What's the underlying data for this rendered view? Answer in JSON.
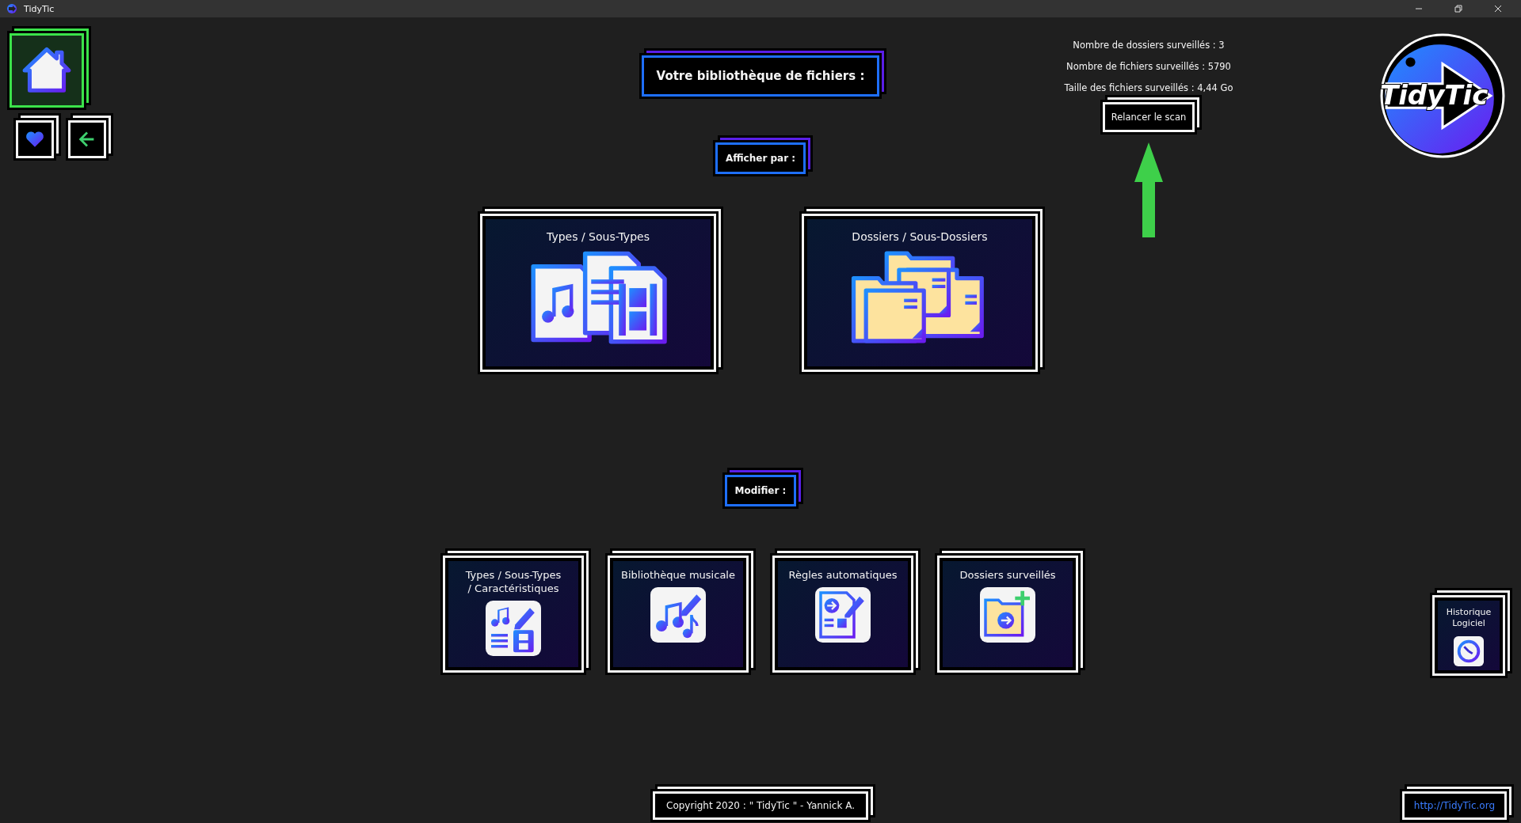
{
  "window": {
    "title": "TidyTic"
  },
  "nav_buttons": [
    {
      "kind": "home",
      "selected": true
    },
    {
      "kind": "favorites",
      "selected": false
    },
    {
      "kind": "back",
      "selected": false
    }
  ],
  "header": "Votre bibliothèque de fichiers :",
  "stats": [
    "Nombre de dossiers surveillés : 3",
    "Nombre de fichiers surveillés : 5790",
    "Taille des fichiers surveillés : 4,44 Go"
  ],
  "rescan_button": "Relancer le scan",
  "logo": {
    "text": "TidyTic"
  },
  "display_label": "Afficher par :",
  "display_options": [
    {
      "kind": "types",
      "label": "Types / Sous-Types"
    },
    {
      "kind": "folders",
      "label": "Dossiers / Sous-Dossiers"
    }
  ],
  "modify_label": "Modifier :",
  "modify_options": [
    {
      "kind": "types",
      "label": "Types / Sous-Types\n/ Caractéristiques"
    },
    {
      "kind": "music",
      "label": "Bibliothèque musicale"
    },
    {
      "kind": "rules",
      "label": "Règles automatiques"
    },
    {
      "kind": "folders",
      "label": "Dossiers surveillés"
    }
  ],
  "history_button": "Historique\nLogiciel",
  "footer": {
    "copyright": "Copyright 2020 : \" TidyTic \" - Yannick A.",
    "link": "http://TidyTic.org"
  }
}
